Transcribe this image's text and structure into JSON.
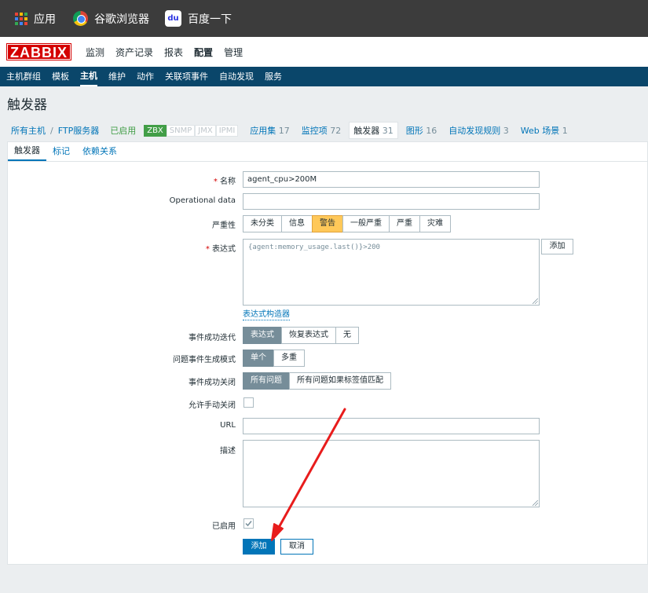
{
  "bookmarks": [
    {
      "icon": "apps-grid-icon",
      "label": "应用"
    },
    {
      "icon": "chrome-icon",
      "label": "谷歌浏览器"
    },
    {
      "icon": "baidu-paw-icon",
      "label": "百度一下"
    }
  ],
  "logo": "ZABBIX",
  "main_menu": [
    "监测",
    "资产记录",
    "报表",
    "配置",
    "管理"
  ],
  "main_menu_active": "配置",
  "sub_menu": [
    "主机群组",
    "模板",
    "主机",
    "维护",
    "动作",
    "关联项事件",
    "自动发现",
    "服务"
  ],
  "sub_menu_active": "主机",
  "page_title": "触发器",
  "breadcrumb": {
    "all_hosts": "所有主机",
    "sep": "/",
    "host": "FTP服务器",
    "status": "已启用",
    "interfaces": [
      "ZBX",
      "SNMP",
      "JMX",
      "IPMI"
    ],
    "items": [
      {
        "label": "应用集",
        "count": "17"
      },
      {
        "label": "监控项",
        "count": "72"
      },
      {
        "label": "触发器",
        "count": "31"
      },
      {
        "label": "图形",
        "count": "16"
      },
      {
        "label": "自动发现规则",
        "count": "3"
      },
      {
        "label": "Web 场景",
        "count": "1"
      }
    ]
  },
  "tabs": [
    "触发器",
    "标记",
    "依赖关系"
  ],
  "form": {
    "name_label": "名称",
    "name_value": "agent_cpu>200M",
    "opdata_label": "Operational data",
    "opdata_value": "",
    "severity_label": "严重性",
    "severity_options": [
      "未分类",
      "信息",
      "警告",
      "一般严重",
      "严重",
      "灾难"
    ],
    "severity_selected": "警告",
    "expression_label": "表达式",
    "expression_value": "{agent:memory_usage.last()}>200",
    "expression_add": "添加",
    "expression_builder": "表达式构造器",
    "ok_event_label": "事件成功迭代",
    "ok_event_options": [
      "表达式",
      "恢复表达式",
      "无"
    ],
    "ok_event_selected": "表达式",
    "gen_mode_label": "问题事件生成模式",
    "gen_mode_options": [
      "单个",
      "多重"
    ],
    "gen_mode_selected": "单个",
    "ok_close_label": "事件成功关闭",
    "ok_close_options": [
      "所有问题",
      "所有问题如果标签值匹配"
    ],
    "ok_close_selected": "所有问题",
    "manual_close_label": "允许手动关闭",
    "manual_close_checked": false,
    "url_label": "URL",
    "url_value": "",
    "desc_label": "描述",
    "desc_value": "",
    "enabled_label": "已启用",
    "enabled_checked": true,
    "add_button": "添加",
    "cancel_button": "取消"
  },
  "required_mark": "*",
  "colors": {
    "bookmark_bar": "#3c3c3c",
    "brand_red": "#d40000",
    "submenu_bg": "#0a466a",
    "link_blue": "#0275b8",
    "warning": "#ffc859",
    "annotation_arrow": "#e81c1c"
  }
}
